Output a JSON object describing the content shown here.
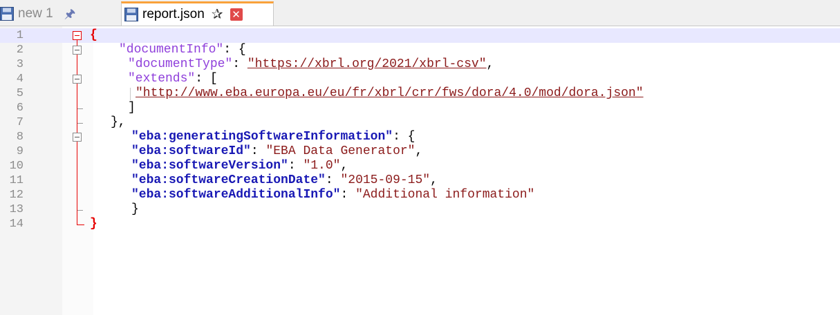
{
  "tabs": [
    {
      "label": "new 1",
      "active": false
    },
    {
      "label": "report.json",
      "active": true
    }
  ],
  "icons": {
    "disk": "floppy-disk-icon",
    "pin": "pin-icon",
    "close": "close-icon"
  },
  "colors": {
    "active_tab_accent": "#f9a13a",
    "fold_marker": "#e60000",
    "current_line": "#e8e8ff"
  },
  "lines": [
    {
      "num": "1"
    },
    {
      "num": "2"
    },
    {
      "num": "3"
    },
    {
      "num": "4"
    },
    {
      "num": "5"
    },
    {
      "num": "6"
    },
    {
      "num": "7"
    },
    {
      "num": "8"
    },
    {
      "num": "9"
    },
    {
      "num": "10"
    },
    {
      "num": "11"
    },
    {
      "num": "12"
    },
    {
      "num": "13"
    },
    {
      "num": "14"
    }
  ],
  "code": {
    "l1": {
      "open": "{"
    },
    "l2": {
      "key": "\"documentInfo\"",
      "rest": ": {"
    },
    "l3": {
      "key": "\"documentType\"",
      "colon": ": ",
      "value": "\"https://xbrl.org/2021/xbrl-csv\"",
      "tail": ","
    },
    "l4": {
      "key": "\"extends\"",
      "rest": ": ["
    },
    "l5": {
      "value": "\"http://www.eba.europa.eu/eu/fr/xbrl/crr/fws/dora/4.0/mod/dora.json\""
    },
    "l6": {
      "text": "]"
    },
    "l7": {
      "text": "},"
    },
    "l8": {
      "key": "\"eba:generatingSoftwareInformation\"",
      "rest": ": {"
    },
    "l9": {
      "key": "\"eba:softwareId\"",
      "colon": ": ",
      "value": "\"EBA Data Generator\"",
      "tail": ","
    },
    "l10": {
      "key": "\"eba:softwareVersion\"",
      "colon": ": ",
      "value": "\"1.0\"",
      "tail": ","
    },
    "l11": {
      "key": "\"eba:softwareCreationDate\"",
      "colon": ": ",
      "value": "\"2015-09-15\"",
      "tail": ","
    },
    "l12": {
      "key": "\"eba:softwareAdditionalInfo\"",
      "colon": ": ",
      "value": "\"Additional information\""
    },
    "l13": {
      "text": "}"
    },
    "l14": {
      "close": "}"
    }
  }
}
